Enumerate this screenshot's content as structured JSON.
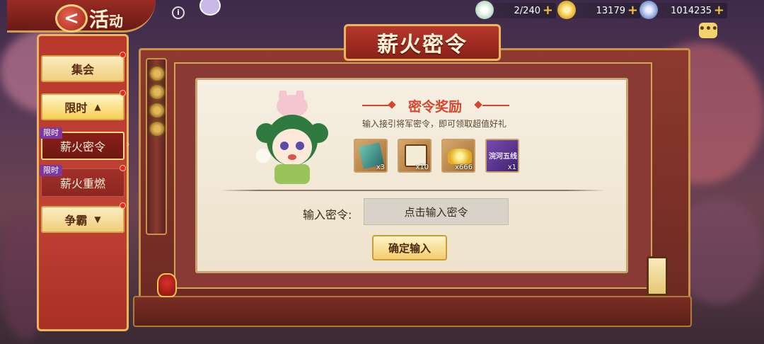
{
  "header": {
    "title_part1": "活",
    "title_part2": "动",
    "back_glyph": "<",
    "info_glyph": "i"
  },
  "resources": [
    {
      "name": "stamina",
      "value": "2/240",
      "icon": "stamina-orb-icon"
    },
    {
      "name": "gold-ingot",
      "value": "13179",
      "icon": "gold-ingot-icon"
    },
    {
      "name": "coin",
      "value": "1014235",
      "icon": "silver-coin-icon"
    }
  ],
  "plus_glyph": "+",
  "chat_glyph": "•••",
  "sidebar": {
    "items": [
      {
        "label": "集会",
        "type": "button"
      },
      {
        "label": "限时",
        "type": "button",
        "expanded": true,
        "arrow": "▲"
      },
      {
        "label": "薪火密令",
        "type": "sub",
        "tag": "限时",
        "active": true
      },
      {
        "label": "薪火重燃",
        "type": "sub",
        "tag": "限时",
        "active": false
      },
      {
        "label": "争霸",
        "type": "button",
        "expanded": false,
        "arrow": "▼"
      }
    ]
  },
  "main": {
    "plate_title": "薪火密令",
    "section_title": "密令奖励",
    "subtitle": "输入接引将军密令，即可领取超值好礼",
    "rewards": [
      {
        "icon": "jade-token-card-icon",
        "count": "x3"
      },
      {
        "icon": "scroll-portrait-icon",
        "count": "x10"
      },
      {
        "icon": "gold-ingot-icon",
        "count": "x666"
      },
      {
        "icon": "purple-title-card-icon",
        "count": "x1",
        "label": "浣河五线"
      }
    ],
    "password_label": "输入密令:",
    "password_placeholder": "点击输入密令",
    "confirm_label": "确定输入"
  }
}
